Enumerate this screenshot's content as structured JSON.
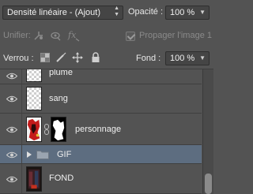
{
  "toolbar": {
    "blend_mode": "Densité linéaire - (Ajout)",
    "opacity_label": "Opacité :",
    "opacity_value": "100 %",
    "unify_label": "Unifier:",
    "propagate_label": "Propager l'image 1",
    "lock_label": "Verrou :",
    "fill_label": "Fond :",
    "fill_value": "100 %"
  },
  "layers": [
    {
      "name": "plume",
      "thumb": "checker",
      "visible": true
    },
    {
      "name": "sang",
      "thumb": "checker",
      "visible": true
    },
    {
      "name": "personnage",
      "thumb": "image-red",
      "mask": true,
      "linked": true,
      "visible": true
    },
    {
      "name": "GIF",
      "type": "group",
      "selected": true,
      "visible": true
    },
    {
      "name": "FOND",
      "thumb": "image-dark",
      "visible": true
    }
  ],
  "colors": {
    "panel_bg": "#535353",
    "selected_row": "#5d6d80",
    "field_bg": "#454545"
  }
}
